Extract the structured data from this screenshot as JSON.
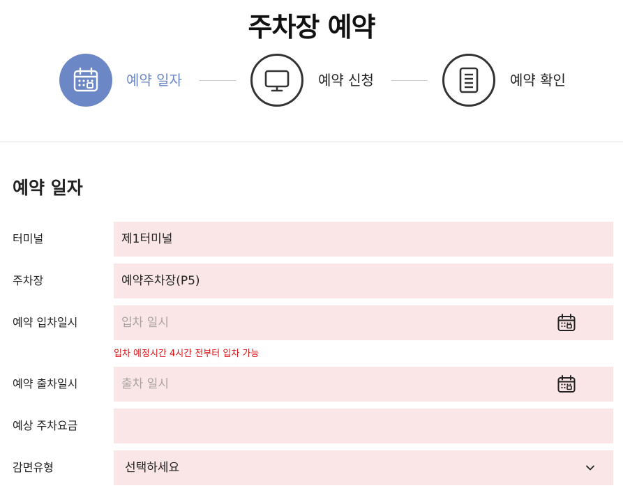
{
  "page": {
    "title": "주차장 예약"
  },
  "steps": [
    {
      "label": "예약 일자",
      "icon": "calendar-icon",
      "active": true
    },
    {
      "label": "예약 신청",
      "icon": "monitor-icon",
      "active": false
    },
    {
      "label": "예약 확인",
      "icon": "document-icon",
      "active": false
    }
  ],
  "colors": {
    "accent": "#6b87c6",
    "field_bg": "#fae6e6",
    "hint": "#d91616"
  },
  "section": {
    "title": "예약 일자"
  },
  "form": {
    "terminal": {
      "label": "터미널",
      "value": "제1터미널"
    },
    "parking": {
      "label": "주차장",
      "value": "예약주차장(P5)"
    },
    "entry": {
      "label": "예약 입차일시",
      "placeholder": "입차 일시",
      "icon": "calendar-icon"
    },
    "entry_hint": "입차 예정시간 4시간 전부터 입차 가능",
    "exit": {
      "label": "예약 출차일시",
      "placeholder": "출차 일시",
      "icon": "calendar-icon"
    },
    "fee": {
      "label": "예상 주차요금",
      "value": ""
    },
    "discount": {
      "label": "감면유형",
      "value": "선택하세요",
      "icon": "chevron-down-icon"
    }
  }
}
